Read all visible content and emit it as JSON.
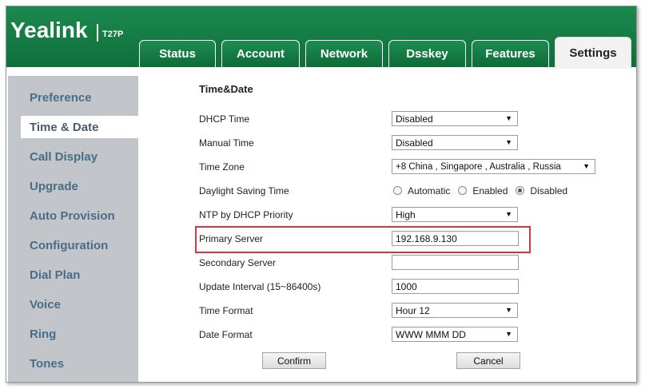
{
  "header": {
    "logo": "Yealink",
    "model": "T27P",
    "tabs": [
      {
        "label": "Status"
      },
      {
        "label": "Account"
      },
      {
        "label": "Network"
      },
      {
        "label": "Dsskey"
      },
      {
        "label": "Features"
      },
      {
        "label": "Settings",
        "active": true
      }
    ]
  },
  "sidebar": {
    "items": [
      {
        "label": "Preference"
      },
      {
        "label": "Time & Date",
        "active": true
      },
      {
        "label": "Call Display"
      },
      {
        "label": "Upgrade"
      },
      {
        "label": "Auto Provision"
      },
      {
        "label": "Configuration"
      },
      {
        "label": "Dial Plan"
      },
      {
        "label": "Voice"
      },
      {
        "label": "Ring"
      },
      {
        "label": "Tones"
      }
    ]
  },
  "form": {
    "title": "Time&Date",
    "dhcp_time": {
      "label": "DHCP Time",
      "value": "Disabled"
    },
    "manual_time": {
      "label": "Manual Time",
      "value": "Disabled"
    },
    "time_zone": {
      "label": "Time Zone",
      "value": "+8 China , Singapore , Australia , Russia"
    },
    "daylight_saving": {
      "label": "Daylight Saving Time",
      "options": [
        "Automatic",
        "Enabled",
        "Disabled"
      ],
      "selected": "Disabled"
    },
    "ntp_priority": {
      "label": "NTP by DHCP Priority",
      "value": "High"
    },
    "primary_server": {
      "label": "Primary Server",
      "value": "192.168.9.130"
    },
    "secondary_server": {
      "label": "Secondary Server",
      "value": ""
    },
    "update_interval": {
      "label": "Update Interval (15~86400s)",
      "value": "1000"
    },
    "time_format": {
      "label": "Time Format",
      "value": "Hour 12"
    },
    "date_format": {
      "label": "Date Format",
      "value": "WWW MMM DD"
    }
  },
  "buttons": {
    "confirm": "Confirm",
    "cancel": "Cancel"
  },
  "colors": {
    "brand_green": "#0f6f3a",
    "highlight_red": "#e0313c",
    "sidebar_text": "#4a6d87"
  },
  "icons": {
    "dropdown": "triangle-down-icon"
  }
}
